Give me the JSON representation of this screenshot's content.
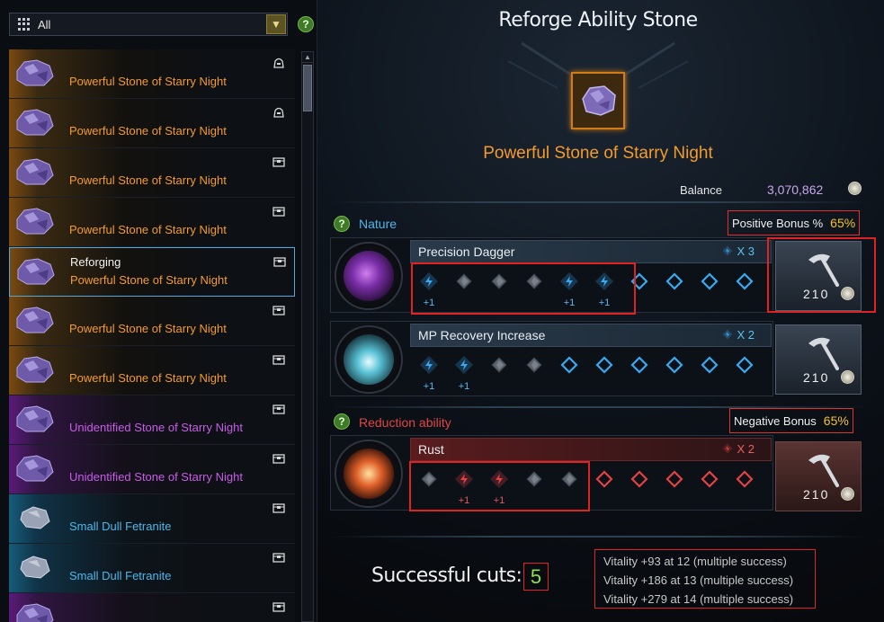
{
  "filter": {
    "label": "All",
    "help": "?"
  },
  "list": [
    {
      "name": "Powerful Stone of Starry Night",
      "rarity": "orange",
      "tag": "",
      "icon": "bag-icon"
    },
    {
      "name": "Powerful Stone of Starry Night",
      "rarity": "orange",
      "tag": "",
      "icon": "bag-icon"
    },
    {
      "name": "Powerful Stone of Starry Night",
      "rarity": "orange",
      "tag": "",
      "icon": "chest-icon"
    },
    {
      "name": "Powerful Stone of Starry Night",
      "rarity": "orange",
      "tag": "",
      "icon": "chest-icon"
    },
    {
      "name": "Powerful Stone of Starry Night",
      "rarity": "orange",
      "tag": "Reforging",
      "icon": "chest-icon",
      "selected": true
    },
    {
      "name": "Powerful Stone of Starry Night",
      "rarity": "orange",
      "tag": "",
      "icon": "chest-icon"
    },
    {
      "name": "Powerful Stone of Starry Night",
      "rarity": "orange",
      "tag": "",
      "icon": "chest-icon"
    },
    {
      "name": "Unidentified Stone of Starry Night",
      "rarity": "purple",
      "tag": "",
      "icon": "chest-icon"
    },
    {
      "name": "Unidentified Stone of Starry Night",
      "rarity": "purple",
      "tag": "",
      "icon": "chest-icon"
    },
    {
      "name": "Small Dull Fetranite",
      "rarity": "blue",
      "tag": "",
      "icon": "chest-icon"
    },
    {
      "name": "Small Dull Fetranite",
      "rarity": "blue",
      "tag": "",
      "icon": "chest-icon"
    },
    {
      "name": "",
      "rarity": "purple",
      "tag": "",
      "icon": "chest-icon"
    }
  ],
  "header": {
    "title": "Reforge Ability Stone",
    "stone_name": "Powerful Stone of Starry Night"
  },
  "balance": {
    "label": "Balance",
    "value": "3,070,862"
  },
  "nature": {
    "label": "Nature",
    "help": "?",
    "bonus_label": "Positive Bonus %",
    "bonus_value": "65%"
  },
  "reduction": {
    "label": "Reduction ability",
    "help": "?",
    "bonus_label": "Negative Bonus",
    "bonus_value": "65%"
  },
  "abilities": [
    {
      "name": "Precision Dagger",
      "multiplier": "X 3",
      "kind": "blue",
      "nodes": [
        "s",
        "f",
        "f",
        "f",
        "s",
        "s",
        "e",
        "e",
        "e",
        "e"
      ],
      "cost": "210"
    },
    {
      "name": "MP Recovery Increase",
      "multiplier": "X 2",
      "kind": "blue",
      "nodes": [
        "s",
        "s",
        "f",
        "f",
        "e",
        "e",
        "e",
        "e",
        "e",
        "e"
      ],
      "cost": "210"
    },
    {
      "name": "Rust",
      "multiplier": "X 2",
      "kind": "red",
      "nodes": [
        "f",
        "s",
        "s",
        "f",
        "f",
        "e",
        "e",
        "e",
        "e",
        "e"
      ],
      "cost": "210"
    }
  ],
  "plus_label": "+1",
  "success": {
    "label": "Successful cuts:",
    "value": "5"
  },
  "vitality": [
    "Vitality +93 at 12 (multiple success)",
    "Vitality +186 at 13 (multiple success)",
    "Vitality +279 at 14 (multiple success)"
  ],
  "colors": {
    "orange": "#f39b2c",
    "purple": "#c85ce9",
    "blue": "#4db7ea",
    "red": "#e04040",
    "highlight": "#e02222"
  }
}
